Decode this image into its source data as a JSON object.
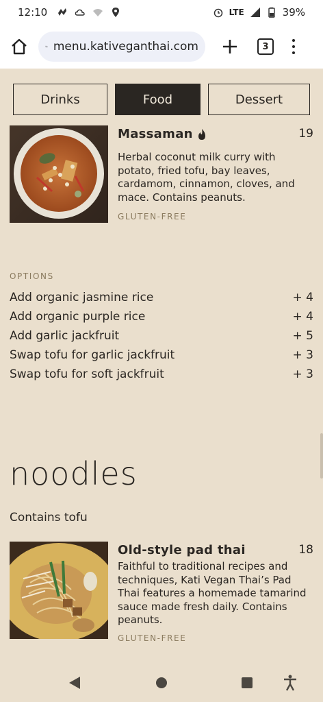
{
  "status": {
    "time": "12:10",
    "network": "LTE",
    "battery": "39%"
  },
  "browser": {
    "url": "menu.kativeganthai.com",
    "tab_count": "3"
  },
  "categories": [
    {
      "label": "Drinks",
      "active": false
    },
    {
      "label": "Food",
      "active": true
    },
    {
      "label": "Dessert",
      "active": false
    }
  ],
  "dishes": [
    {
      "name": "Massaman",
      "price": "19",
      "spicy": true,
      "description": "Herbal coconut milk curry with potato, fried tofu, bay leaves, cardamom, cinnamon, cloves, and mace. Contains peanuts.",
      "tag": "GLUTEN-FREE"
    },
    {
      "name": "Old-style pad thai",
      "price": "18",
      "spicy": false,
      "description": "Faithful to traditional recipes and techniques, Kati Vegan Thai’s Pad Thai features a homemade tamarind sauce made fresh daily. Contains peanuts.",
      "tag": "GLUTEN-FREE"
    }
  ],
  "options": {
    "label": "OPTIONS",
    "items": [
      {
        "label": "Add organic jasmine rice",
        "price": "+ 4"
      },
      {
        "label": "Add organic purple rice",
        "price": "+ 4"
      },
      {
        "label": "Add garlic jackfruit",
        "price": "+ 5"
      },
      {
        "label": "Swap tofu for garlic jackfruit",
        "price": "+ 3"
      },
      {
        "label": "Swap tofu for soft jackfruit",
        "price": "+ 3"
      }
    ]
  },
  "section": {
    "title": "noodles",
    "note": "Contains tofu"
  },
  "icons": {
    "home": "home-icon",
    "tune": "site-settings-icon",
    "new_tab": "plus-icon",
    "more": "more-vert-icon",
    "spicy": "flame-icon"
  }
}
